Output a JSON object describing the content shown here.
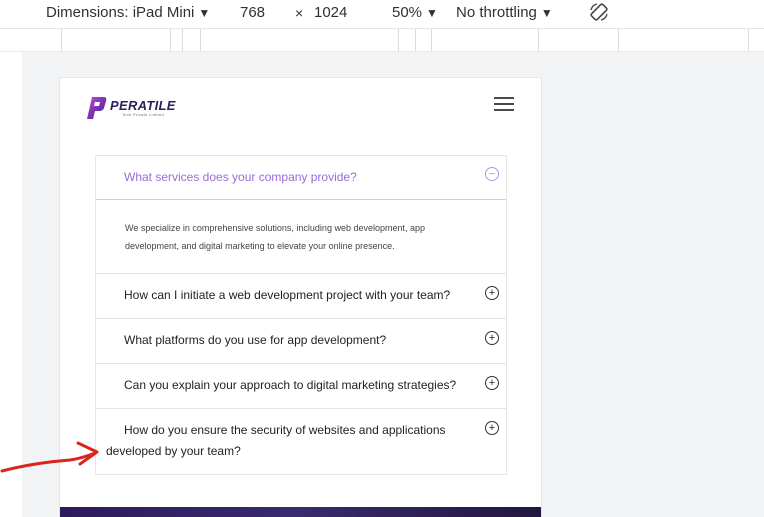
{
  "toolbar": {
    "dimensions_label": "Dimensions: iPad Mini",
    "width": "768",
    "times": "×",
    "height": "1024",
    "zoom": "50%",
    "throttling": "No throttling",
    "rotate_icon": "rotate-icon"
  },
  "colors": {
    "accent": "#9b6ad8",
    "brand_dark": "#2b1f5e",
    "annotation": "#d9261c"
  },
  "header": {
    "logo_text": "PERATILE",
    "logo_sub": "Tech Private Limited",
    "menu_icon": "hamburger-icon"
  },
  "faq": {
    "items": [
      {
        "question": "What services does your company provide?",
        "answer": "We specialize in comprehensive solutions, including web development, app development, and digital marketing to elevate your online presence.",
        "toggle": "⊖"
      },
      {
        "question": "How can I initiate a web development project with your team?",
        "toggle": "⊕"
      },
      {
        "question": "What platforms do you use for app development?",
        "toggle": "⊕"
      },
      {
        "question": "Can you explain your approach to digital marketing strategies?",
        "toggle": "⊕"
      },
      {
        "question": "How do you ensure the security of websites and applications developed by your team?",
        "toggle": "⊕"
      }
    ]
  }
}
